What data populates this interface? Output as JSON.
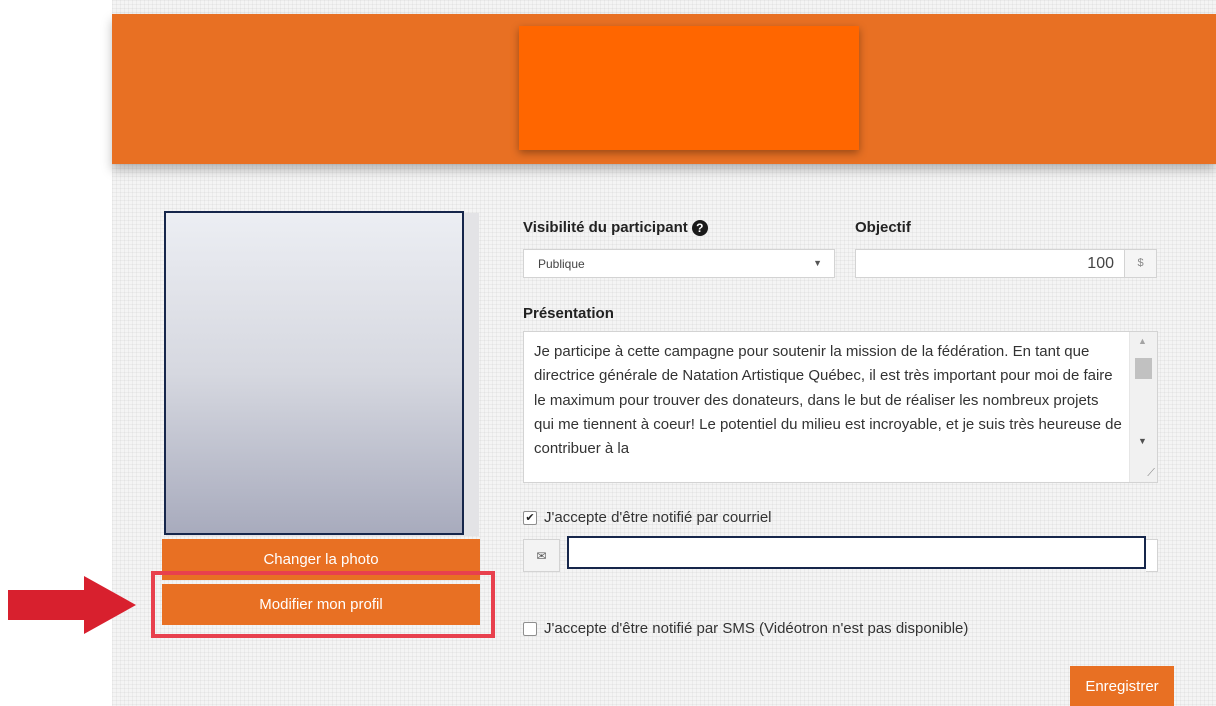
{
  "colors": {
    "header": "#e87023",
    "logo": "#ff6600",
    "button": "#e87023",
    "highlight": "#e8404d",
    "arrow": "#d8202e"
  },
  "photo_panel": {
    "change_photo_label": "Changer la photo",
    "edit_profile_label": "Modifier mon profil"
  },
  "form": {
    "visibility_label": "Visibilité du participant",
    "visibility_help_icon": "question-circle-icon",
    "visibility_value": "Publique",
    "objective_label": "Objectif",
    "objective_value": "100",
    "currency": "$",
    "presentation_label": "Présentation",
    "presentation_text": "Je participe à cette campagne pour soutenir la mission de la fédération. En tant que directrice générale de Natation Artistique Québec, il est très important pour moi de faire le maximum pour trouver des donateurs, dans le but de réaliser les nombreux projets qui me tiennent à coeur! Le potentiel du milieu est incroyable, et je suis très heureuse de contribuer à la",
    "email_notify_label": "J'accepte d'être notifié par courriel",
    "email_notify_checked": true,
    "email_icon": "envelope-icon",
    "email_value": "",
    "sms_notify_label": "J'accepte d'être notifié par SMS (Vidéotron n'est pas disponible)",
    "sms_notify_checked": false,
    "save_label": "Enregistrer"
  }
}
